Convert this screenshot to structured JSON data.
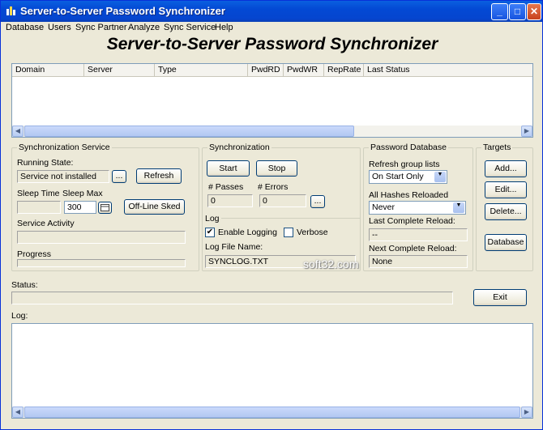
{
  "window": {
    "title": "Server-to-Server Password Synchronizer",
    "controls": {
      "minimize": "_",
      "maximize": "□",
      "close": "✕"
    }
  },
  "menu": [
    "Database",
    "Users",
    "Sync Partner",
    "Analyze",
    "Sync Service",
    "Help"
  ],
  "banner": "Server-to-Server Password Synchronizer",
  "list": {
    "columns": [
      "Domain",
      "Server",
      "Type",
      "PwdRD",
      "PwdWR",
      "RepRate",
      "Last Status"
    ],
    "rows": []
  },
  "sync_service": {
    "title": "Synchronization Service",
    "running_state_label": "Running State:",
    "running_state_value": "Service not installed",
    "browse_label": "...",
    "refresh_label": "Refresh",
    "sleep_time_label": "Sleep Time",
    "sleep_max_label": "Sleep Max",
    "sleep_time_value": "",
    "sleep_max_value": "300",
    "offline_sked_label": "Off-Line Sked",
    "service_activity_label": "Service Activity",
    "service_activity_value": "",
    "progress_label": "Progress",
    "progress": 0
  },
  "synchronization": {
    "title": "Synchronization",
    "start_label": "Start",
    "stop_label": "Stop",
    "passes_label": "# Passes",
    "errors_label": "# Errors",
    "passes_value": "0",
    "errors_value": "0",
    "browse_label": "..."
  },
  "log_group": {
    "title": "Log",
    "enable_logging_label": "Enable Logging",
    "enable_logging_checked": true,
    "verbose_label": "Verbose",
    "verbose_checked": false,
    "log_file_label": "Log File Name:",
    "log_file_value": "SYNCLOG.TXT"
  },
  "password_db": {
    "title": "Password Database",
    "refresh_group_label": "Refresh group lists",
    "refresh_group_value": "On Start Only",
    "all_hashes_label": "All Hashes Reloaded",
    "all_hashes_value": "Never",
    "last_reload_label": "Last Complete Reload:",
    "last_reload_value": "--",
    "next_reload_label": "Next Complete Reload:",
    "next_reload_value": "None"
  },
  "targets": {
    "title": "Targets",
    "add_label": "Add...",
    "edit_label": "Edit...",
    "delete_label": "Delete...",
    "database_label": "Database"
  },
  "status": {
    "label": "Status:",
    "value": ""
  },
  "exit_label": "Exit",
  "log": {
    "label": "Log:",
    "value": ""
  },
  "watermark": "soft32.com",
  "colors": {
    "titlebar": "#0349d4",
    "face": "#ece9d8",
    "border": "#7f9db9"
  }
}
